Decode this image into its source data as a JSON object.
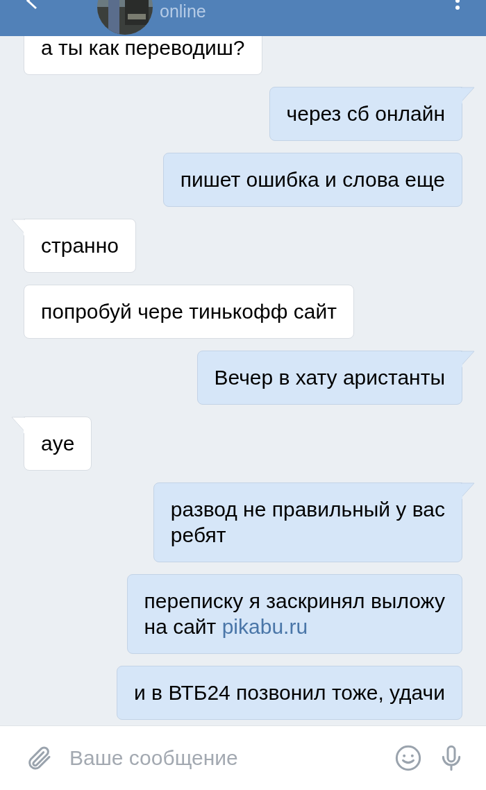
{
  "header": {
    "status": "online"
  },
  "messages": [
    {
      "kind": "incoming",
      "text": "а ты как переводиш?"
    },
    {
      "kind": "outgoing",
      "tail": true,
      "text": "через сб онлайн"
    },
    {
      "kind": "outgoing",
      "tail": false,
      "text": "пишет ошибка и слова еще"
    },
    {
      "kind": "incoming",
      "tail": true,
      "text": "странно"
    },
    {
      "kind": "incoming",
      "tail": false,
      "text": "попробуй чере тинькофф сайт"
    },
    {
      "kind": "outgoing",
      "tail": true,
      "text": "Вечер в хату аристанты"
    },
    {
      "kind": "incoming",
      "tail": true,
      "text": "aye"
    },
    {
      "kind": "outgoing",
      "tail": true,
      "text": "развод не правильный у вас\nребят"
    },
    {
      "kind": "outgoing",
      "tail": false,
      "text": "переписку я заскринял выложу\nна сайт ",
      "link": "pikabu.ru"
    },
    {
      "kind": "outgoing",
      "tail": false,
      "text": "и в ВТБ24 позвонил тоже, удачи"
    }
  ],
  "composer": {
    "placeholder": "Ваше сообщение"
  }
}
